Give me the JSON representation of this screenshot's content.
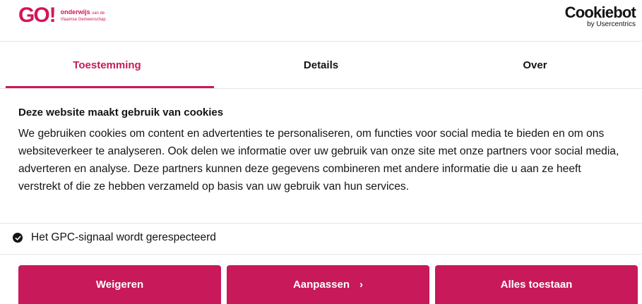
{
  "header": {
    "logo": {
      "mark": "GO",
      "bang": "!",
      "line1_main": "onderwijs",
      "line1_small": "van de",
      "line2": "Vlaamse Gemeenschap"
    },
    "cookiebot": {
      "name": "Cookiebot",
      "sub": "by Usercentrics"
    }
  },
  "tabs": [
    {
      "label": "Toestemming",
      "active": true
    },
    {
      "label": "Details",
      "active": false
    },
    {
      "label": "Over",
      "active": false
    }
  ],
  "content": {
    "heading": "Deze website maakt gebruik van cookies",
    "body": "We gebruiken cookies om content en advertenties te personaliseren, om functies voor social media te bieden en om ons websiteverkeer te analyseren. Ook delen we informatie over uw gebruik van onze site met onze partners voor social media, adverteren en analyse. Deze partners kunnen deze gegevens combineren met andere informatie die u aan ze heeft verstrekt of die ze hebben verzameld op basis van uw gebruik van hun services."
  },
  "gpc": {
    "label": "Het GPC-signaal wordt gerespecteerd",
    "icon": "check-circle-icon"
  },
  "buttons": {
    "decline": "Weigeren",
    "customize": "Aanpassen",
    "customize_chevron": "›",
    "allow_all": "Alles toestaan"
  },
  "colors": {
    "accent": "#c8195a",
    "text": "#141414",
    "divider": "#e6e6e6"
  }
}
